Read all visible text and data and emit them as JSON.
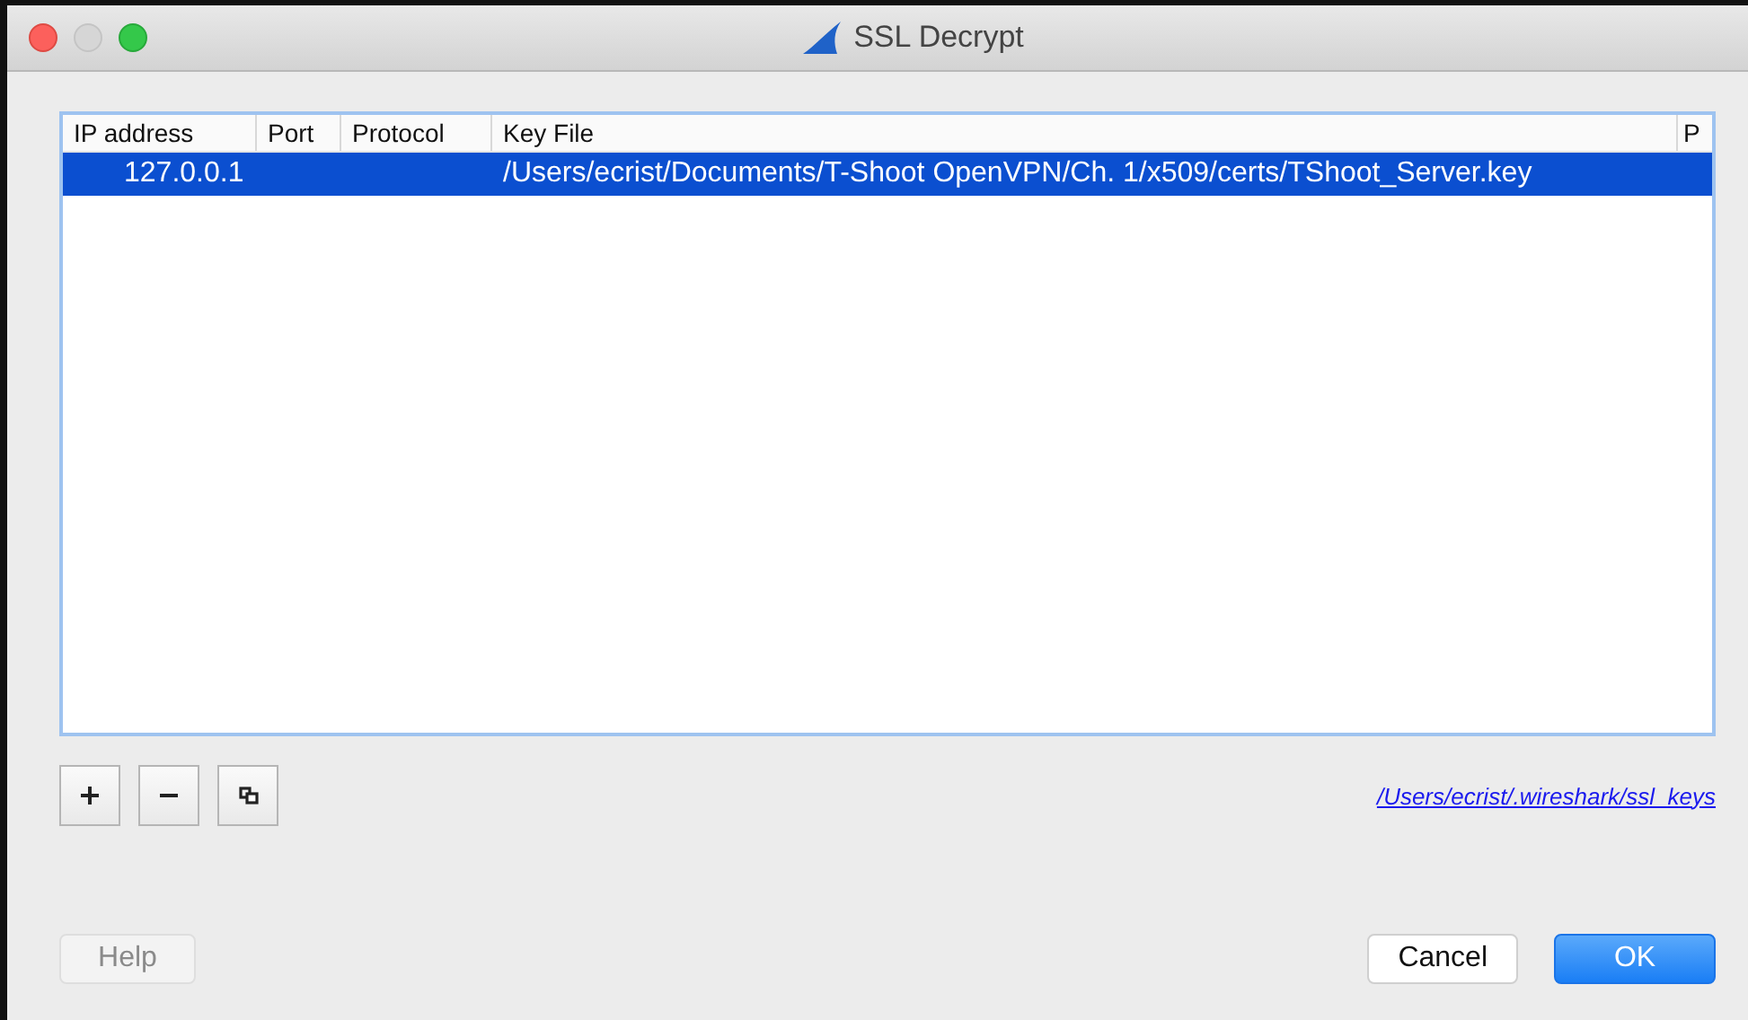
{
  "window": {
    "title": "SSL Decrypt"
  },
  "table": {
    "columns": [
      "IP address",
      "Port",
      "Protocol",
      "Key File",
      "P"
    ],
    "rows": [
      {
        "cells": [
          "127.0.0.1",
          "",
          "",
          "/Users/ecrist/Documents/T-Shoot OpenVPN/Ch. 1/x509/certs/TShoot_Server.key"
        ],
        "selected": true
      }
    ]
  },
  "toolbar": [
    {
      "kind": "add"
    },
    {
      "kind": "remove"
    },
    {
      "kind": "copy"
    }
  ],
  "file_link": "/Users/ecrist/.wireshark/ssl_keys",
  "buttons": [
    {
      "label": "Help",
      "disabled": true,
      "default": false
    },
    {
      "label": "Cancel",
      "disabled": false,
      "default": false
    },
    {
      "label": "OK",
      "disabled": false,
      "default": true
    }
  ]
}
